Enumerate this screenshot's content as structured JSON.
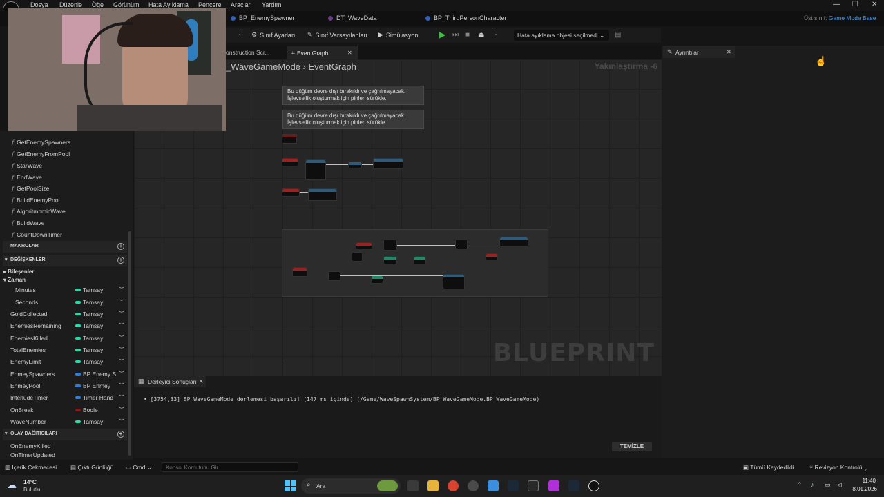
{
  "menu": [
    "Dosya",
    "Düzenle",
    "Öğe",
    "Görünüm",
    "Hata Ayıklama",
    "Pencere",
    "Araçlar",
    "Yardım"
  ],
  "file_tabs": [
    "BP_EnemySpawner",
    "DT_WaveData",
    "BP_ThirdPersonCharacter"
  ],
  "parent_class": {
    "label": "Üst sınıf:",
    "value": "Game Mode Base"
  },
  "toolbar": {
    "class_settings": "Sınıf Ayarları",
    "class_defaults": "Sınıf Varsayılanları",
    "simulation": "Simülasyon",
    "debug_object": "Hata ayıklama objesi seçilmedi"
  },
  "doc_tabs": {
    "construction": "onstruction Scr...",
    "event_graph": "EventGraph"
  },
  "breadcrumb": {
    "blueprint": "_WaveGameMode",
    "graph": "EventGraph"
  },
  "zoom": "Yakınlaştırma -6",
  "watermark": "BLUEPRINT",
  "comments": [
    {
      "line1": "Bu düğüm devre dışı bırakıldı ve çağrılmayacak.",
      "line2": "İşlevsellik oluşturmak için pinleri sürükle."
    },
    {
      "line1": "Bu düğüm devre dışı bırakıldı ve çağrılmayacak.",
      "line2": "İşlevsellik oluşturmak için pinleri sürükle."
    }
  ],
  "functions": [
    "GetEnemySpawners",
    "GetEnemyFromPool",
    "StarWave",
    "EndWave",
    "GetPoolSize",
    "BuildEnemyPool",
    "AlgoritmhmicWave",
    "BuildWave",
    "CountDownTimer"
  ],
  "sections": {
    "macros": "MAKROLAR",
    "variables": "DEĞİŞKENLER",
    "dispatchers": "OLAY DAĞITICILARI"
  },
  "categories": {
    "components": "Bileşenler",
    "time": "Zaman"
  },
  "variables": [
    {
      "name": "Minutes",
      "type": "Tamsayı",
      "color": "#1fe0a8"
    },
    {
      "name": "Seconds",
      "type": "Tamsayı",
      "color": "#1fe0a8"
    },
    {
      "name": "GoldCollected",
      "type": "Tamsayı",
      "color": "#1fe0a8"
    },
    {
      "name": "EnemiesRemaining",
      "type": "Tamsayı",
      "color": "#1fe0a8"
    },
    {
      "name": "EnemiesKilled",
      "type": "Tamsayı",
      "color": "#1fe0a8"
    },
    {
      "name": "TotalEnemies",
      "type": "Tamsayı",
      "color": "#1fe0a8"
    },
    {
      "name": "EnemyLimit",
      "type": "Tamsayı",
      "color": "#1fe0a8"
    },
    {
      "name": "EnmeySpawners",
      "type": "BP Enemy S",
      "color": "#2f7de0"
    },
    {
      "name": "EnmeyPool",
      "type": "BP Enmey",
      "color": "#2f7de0"
    },
    {
      "name": "InterludeTimer",
      "type": "Timer Hand",
      "color": "#2f7de0"
    },
    {
      "name": "OnBreak",
      "type": "Boole",
      "color": "#a01010"
    },
    {
      "name": "WaveNumber",
      "type": "Tamsayı",
      "color": "#1fe0a8"
    }
  ],
  "dispatchers": [
    "OnEnemyKilled",
    "OnTimerUpdated"
  ],
  "compiler": {
    "tab": "Derleyici Sonuçları",
    "message": "[3754,33] BP_WaveGameMode derlemesi başarılı! [147 ms içinde] (/Game/WaveSpawnSystem/BP_WaveGameMode.BP_WaveGameMode)",
    "clear": "TEMİZLE"
  },
  "details_tab": "Ayrıntılar",
  "statusbar": {
    "content_drawer": "İçerik Çekmecesi",
    "output_log": "Çıktı Günlüğü",
    "cmd": "Cmd",
    "console_placeholder": "Konsol Komutunu Gir",
    "save_all": "Tümü Kaydedildi",
    "revision": "Revizyon Kontrolü"
  },
  "taskbar": {
    "temp": "14°C",
    "weather": "Bulutlu",
    "search": "Ara",
    "time": "11:40",
    "date": "8.01.2026"
  }
}
